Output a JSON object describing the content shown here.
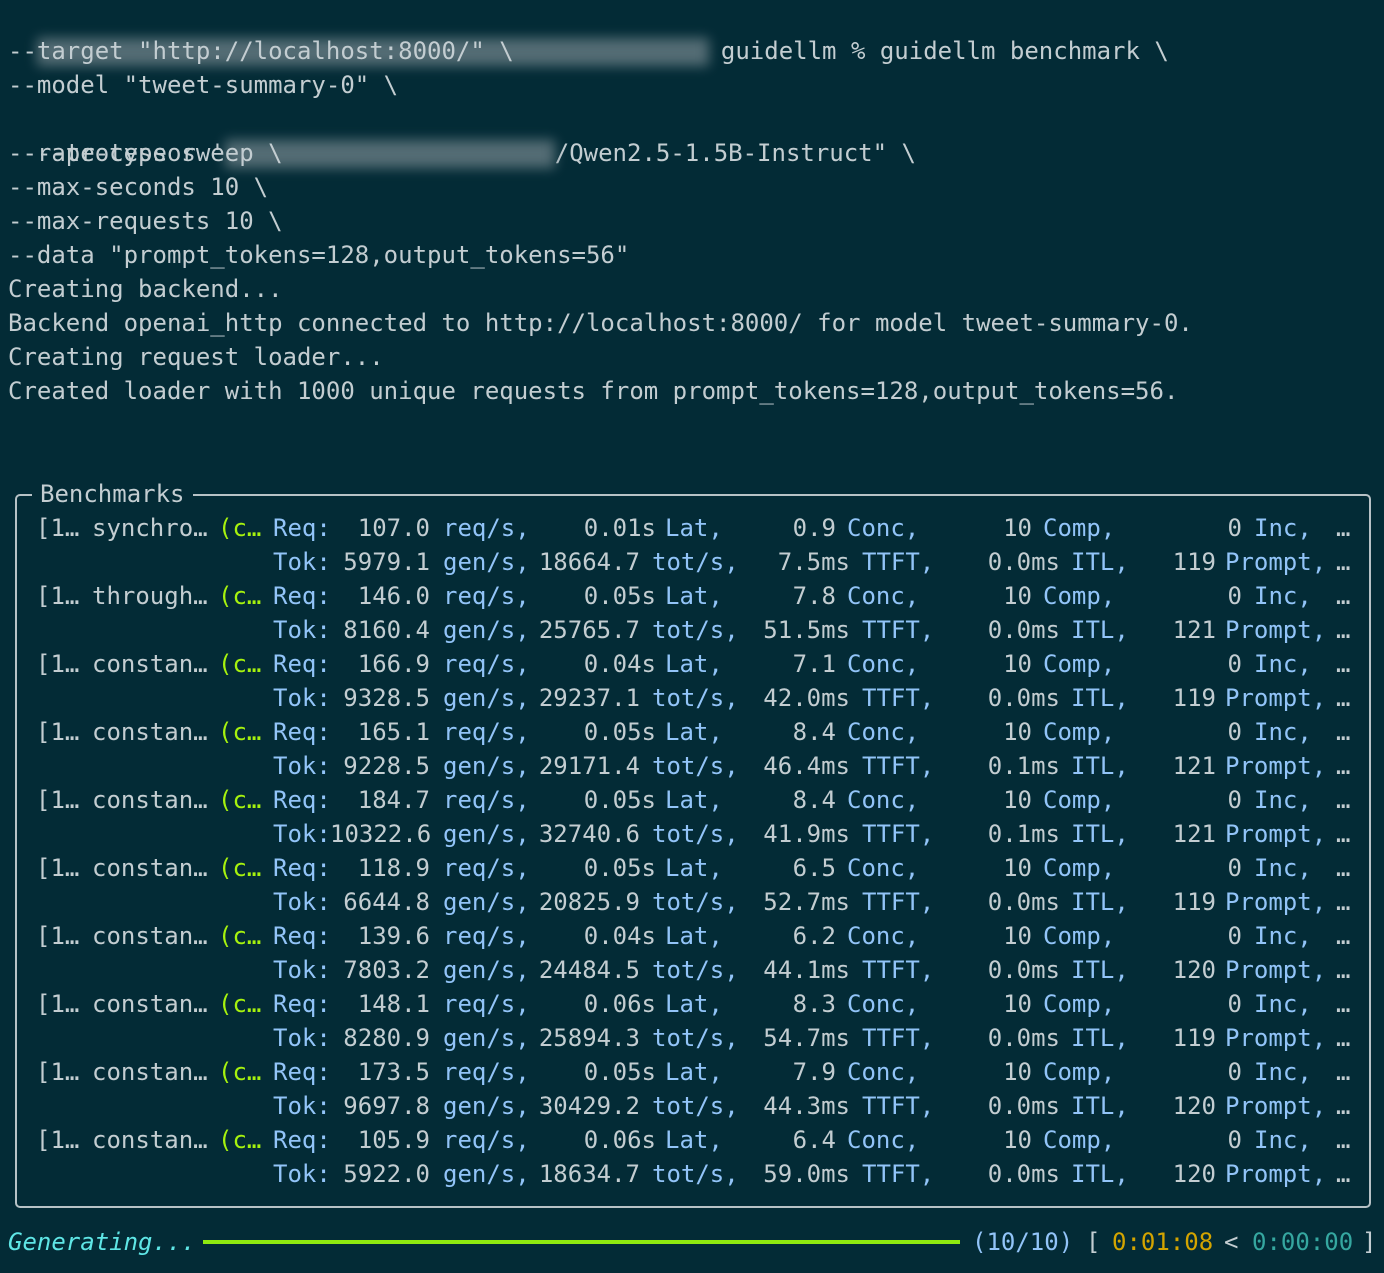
{
  "terminal": {
    "command_lines": [
      "guidellm % guidellm benchmark \\",
      "--target \"http://localhost:8000/\" \\",
      "--model \"tweet-summary-0\" \\",
      "--processor '",
      "--rate-type sweep \\",
      "--max-seconds 10 \\",
      "--max-requests 10 \\",
      "--data \"prompt_tokens=128,output_tokens=56\"",
      "Creating backend...",
      "Backend openai_http connected to http://localhost:8000/ for model tweet-summary-0.",
      "Creating request loader...",
      "Created loader with 1000 unique requests from prompt_tokens=128,output_tokens=56."
    ],
    "processor_suffix": "/Qwen2.5-1.5B-Instruct\" \\"
  },
  "benchmarks": {
    "title": "Benchmarks",
    "labels": {
      "req": "Req:",
      "tok": "Tok:",
      "req_s": "req/s,",
      "lat": "Lat,",
      "conc": "Conc,",
      "comp": "Comp,",
      "inc": "Inc,",
      "gen_s": "gen/s,",
      "tot_s": "tot/s,",
      "ttft": "TTFT,",
      "itl": "ITL,",
      "prompt": "Prompt,",
      "ellipsis": "…"
    },
    "rows": [
      {
        "idx": "[1…",
        "name": "synchro…",
        "status": "(c…",
        "req": "107.0",
        "lat": "0.01s",
        "conc": "0.9",
        "comp": "10",
        "inc": "0",
        "gen": "5979.1",
        "tot": "18664.7",
        "ttft": "7.5ms",
        "itl": "0.0ms",
        "prompt": "119"
      },
      {
        "idx": "[1…",
        "name": "through…",
        "status": "(c…",
        "req": "146.0",
        "lat": "0.05s",
        "conc": "7.8",
        "comp": "10",
        "inc": "0",
        "gen": "8160.4",
        "tot": "25765.7",
        "ttft": "51.5ms",
        "itl": "0.0ms",
        "prompt": "121"
      },
      {
        "idx": "[1…",
        "name": "constan…",
        "status": "(c…",
        "req": "166.9",
        "lat": "0.04s",
        "conc": "7.1",
        "comp": "10",
        "inc": "0",
        "gen": "9328.5",
        "tot": "29237.1",
        "ttft": "42.0ms",
        "itl": "0.0ms",
        "prompt": "119"
      },
      {
        "idx": "[1…",
        "name": "constan…",
        "status": "(c…",
        "req": "165.1",
        "lat": "0.05s",
        "conc": "8.4",
        "comp": "10",
        "inc": "0",
        "gen": "9228.5",
        "tot": "29171.4",
        "ttft": "46.4ms",
        "itl": "0.1ms",
        "prompt": "121"
      },
      {
        "idx": "[1…",
        "name": "constan…",
        "status": "(c…",
        "req": "184.7",
        "lat": "0.05s",
        "conc": "8.4",
        "comp": "10",
        "inc": "0",
        "gen": "10322.6",
        "tot": "32740.6",
        "ttft": "41.9ms",
        "itl": "0.1ms",
        "prompt": "121"
      },
      {
        "idx": "[1…",
        "name": "constan…",
        "status": "(c…",
        "req": "118.9",
        "lat": "0.05s",
        "conc": "6.5",
        "comp": "10",
        "inc": "0",
        "gen": "6644.8",
        "tot": "20825.9",
        "ttft": "52.7ms",
        "itl": "0.0ms",
        "prompt": "119"
      },
      {
        "idx": "[1…",
        "name": "constan…",
        "status": "(c…",
        "req": "139.6",
        "lat": "0.04s",
        "conc": "6.2",
        "comp": "10",
        "inc": "0",
        "gen": "7803.2",
        "tot": "24484.5",
        "ttft": "44.1ms",
        "itl": "0.0ms",
        "prompt": "120"
      },
      {
        "idx": "[1…",
        "name": "constan…",
        "status": "(c…",
        "req": "148.1",
        "lat": "0.06s",
        "conc": "8.3",
        "comp": "10",
        "inc": "0",
        "gen": "8280.9",
        "tot": "25894.3",
        "ttft": "54.7ms",
        "itl": "0.0ms",
        "prompt": "119"
      },
      {
        "idx": "[1…",
        "name": "constan…",
        "status": "(c…",
        "req": "173.5",
        "lat": "0.05s",
        "conc": "7.9",
        "comp": "10",
        "inc": "0",
        "gen": "9697.8",
        "tot": "30429.2",
        "ttft": "44.3ms",
        "itl": "0.0ms",
        "prompt": "120"
      },
      {
        "idx": "[1…",
        "name": "constan…",
        "status": "(c…",
        "req": "105.9",
        "lat": "0.06s",
        "conc": "6.4",
        "comp": "10",
        "inc": "0",
        "gen": "5922.0",
        "tot": "18634.7",
        "ttft": "59.0ms",
        "itl": "0.0ms",
        "prompt": "120"
      }
    ]
  },
  "progress": {
    "label": "Generating...",
    "count": "(10/10)",
    "fraction": 1.0,
    "open_bracket": "[",
    "elapsed": "0:01:08",
    "sep": "<",
    "remaining": "0:00:00",
    "close_bracket": "]"
  },
  "colors": {
    "background": "#032b36",
    "text": "#c3cdd1",
    "keyword": "#92c4f8",
    "status": "#a6f20e",
    "progress_bar": "#8fe910",
    "generating": "#5fe6e6",
    "elapsed": "#d3a400",
    "remaining": "#35a7a0"
  }
}
